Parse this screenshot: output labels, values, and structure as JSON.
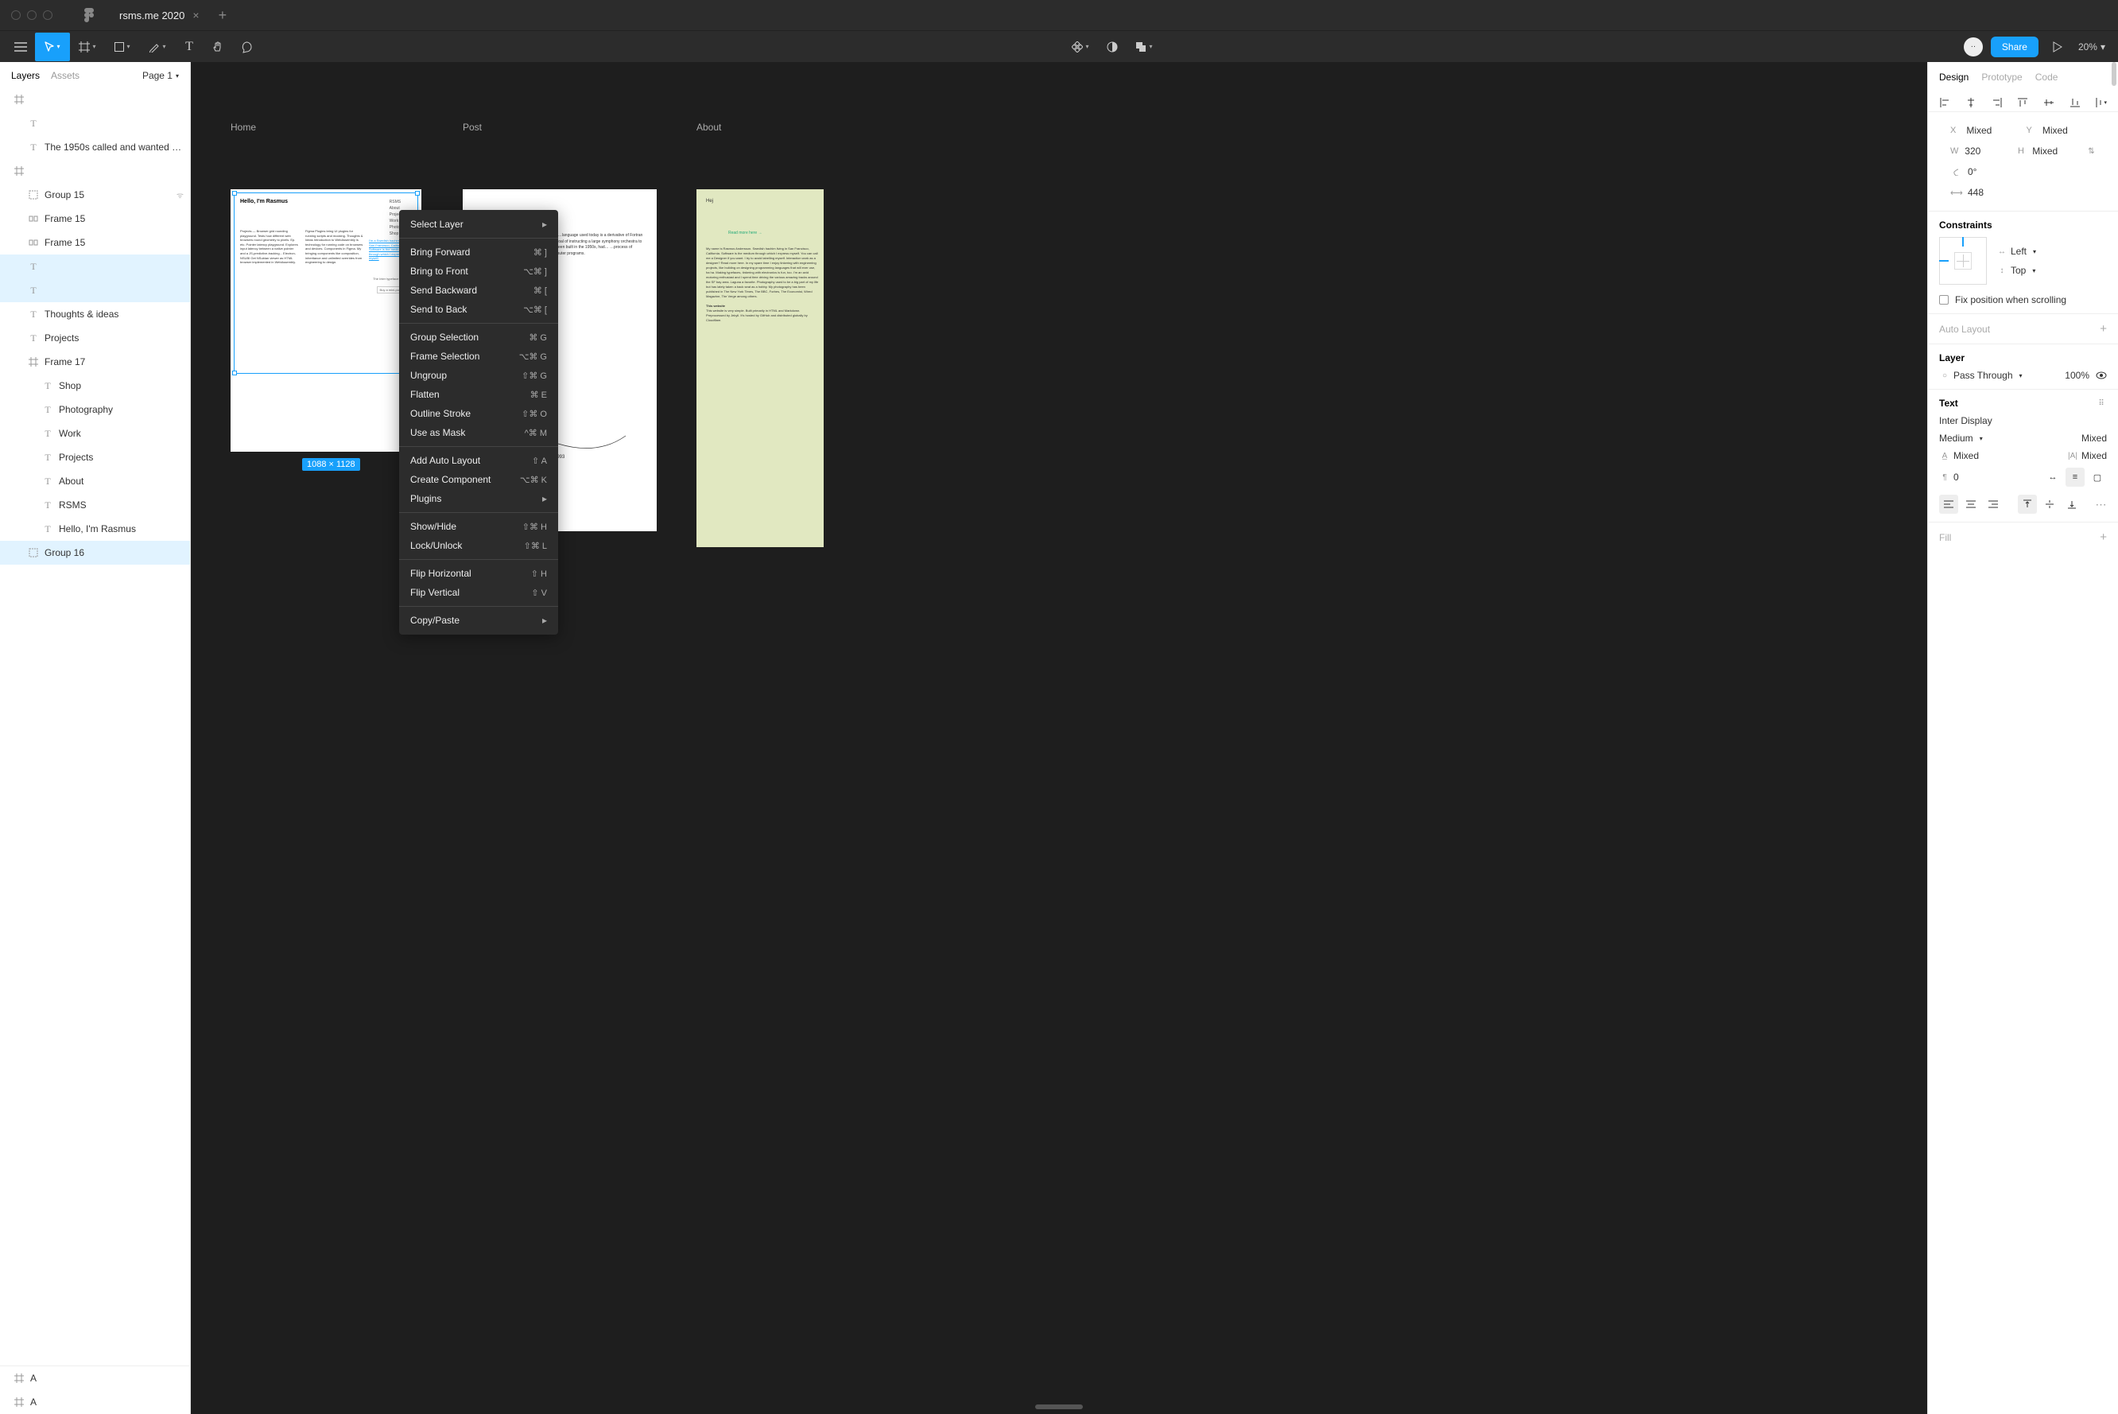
{
  "titlebar": {
    "tab": "rsms.me 2020"
  },
  "toolbar": {
    "share": "Share",
    "zoom": "20%"
  },
  "leftpanel": {
    "tabs": {
      "layers": "Layers",
      "assets": "Assets"
    },
    "page": "Page 1",
    "rows": [
      {
        "icon": "frame",
        "label": "",
        "indent": 0
      },
      {
        "icon": "text",
        "label": "",
        "indent": 1
      },
      {
        "icon": "text",
        "label": "The 1950s called and wanted …",
        "indent": 1
      },
      {
        "icon": "frame",
        "label": "",
        "indent": 0
      },
      {
        "icon": "group",
        "label": "Group 15",
        "indent": 1,
        "hidden": true
      },
      {
        "icon": "component",
        "label": "Frame 15",
        "indent": 1
      },
      {
        "icon": "component",
        "label": "Frame 15",
        "indent": 1
      },
      {
        "icon": "text",
        "label": "",
        "indent": 1,
        "sel": "A"
      },
      {
        "icon": "text",
        "label": "",
        "indent": 1,
        "sel": "A"
      },
      {
        "icon": "text",
        "label": "Thoughts & ideas",
        "indent": 1
      },
      {
        "icon": "text",
        "label": "Projects",
        "indent": 1
      },
      {
        "icon": "frame",
        "label": "Frame 17",
        "indent": 1
      },
      {
        "icon": "text",
        "label": "Shop",
        "indent": 2
      },
      {
        "icon": "text",
        "label": "Photography",
        "indent": 2
      },
      {
        "icon": "text",
        "label": "Work",
        "indent": 2
      },
      {
        "icon": "text",
        "label": "Projects",
        "indent": 2
      },
      {
        "icon": "text",
        "label": "About",
        "indent": 2
      },
      {
        "icon": "text",
        "label": "RSMS",
        "indent": 2
      },
      {
        "icon": "text",
        "label": "Hello, I'm Rasmus",
        "indent": 2
      },
      {
        "icon": "group",
        "label": "Group 16",
        "indent": 1,
        "sel": "B"
      }
    ],
    "bottom": [
      {
        "icon": "frame",
        "label": "A"
      },
      {
        "icon": "frame",
        "label": "A"
      }
    ]
  },
  "canvas": {
    "frames": [
      {
        "name": "Home"
      },
      {
        "name": "Post"
      },
      {
        "name": "About"
      }
    ],
    "selection_dim": "1088 × 1128"
  },
  "contextmenu": {
    "groups": [
      [
        {
          "label": "Select Layer",
          "submenu": true
        }
      ],
      [
        {
          "label": "Bring Forward",
          "shortcut": "⌘ ]"
        },
        {
          "label": "Bring to Front",
          "shortcut": "⌥⌘ ]"
        },
        {
          "label": "Send Backward",
          "shortcut": "⌘ ["
        },
        {
          "label": "Send to Back",
          "shortcut": "⌥⌘ ["
        }
      ],
      [
        {
          "label": "Group Selection",
          "shortcut": "⌘ G"
        },
        {
          "label": "Frame Selection",
          "shortcut": "⌥⌘ G"
        },
        {
          "label": "Ungroup",
          "shortcut": "⇧⌘ G"
        },
        {
          "label": "Flatten",
          "shortcut": "⌘ E"
        },
        {
          "label": "Outline Stroke",
          "shortcut": "⇧⌘ O"
        },
        {
          "label": "Use as Mask",
          "shortcut": "^⌘ M"
        }
      ],
      [
        {
          "label": "Add Auto Layout",
          "shortcut": "⇧ A"
        },
        {
          "label": "Create Component",
          "shortcut": "⌥⌘ K"
        },
        {
          "label": "Plugins",
          "submenu": true
        }
      ],
      [
        {
          "label": "Show/Hide",
          "shortcut": "⇧⌘ H"
        },
        {
          "label": "Lock/Unlock",
          "shortcut": "⇧⌘ L"
        }
      ],
      [
        {
          "label": "Flip Horizontal",
          "shortcut": "⇧ H"
        },
        {
          "label": "Flip Vertical",
          "shortcut": "⇧ V"
        }
      ],
      [
        {
          "label": "Copy/Paste",
          "submenu": true
        }
      ]
    ]
  },
  "rightpanel": {
    "tabs": {
      "design": "Design",
      "prototype": "Prototype",
      "code": "Code"
    },
    "transform": {
      "x": "Mixed",
      "y": "Mixed",
      "w": "320",
      "h": "Mixed",
      "rotation": "0°",
      "corner": "448"
    },
    "constraints": {
      "title": "Constraints",
      "left": "Left",
      "top": "Top",
      "fix": "Fix position when scrolling"
    },
    "autolayout": "Auto Layout",
    "layer": {
      "title": "Layer",
      "blend": "Pass Through",
      "opacity": "100%"
    },
    "text": {
      "title": "Text",
      "font": "Inter Display",
      "weight": "Medium",
      "size": "Mixed",
      "letter": "Mixed",
      "line": "Mixed",
      "para": "0"
    },
    "fill": "Fill"
  }
}
